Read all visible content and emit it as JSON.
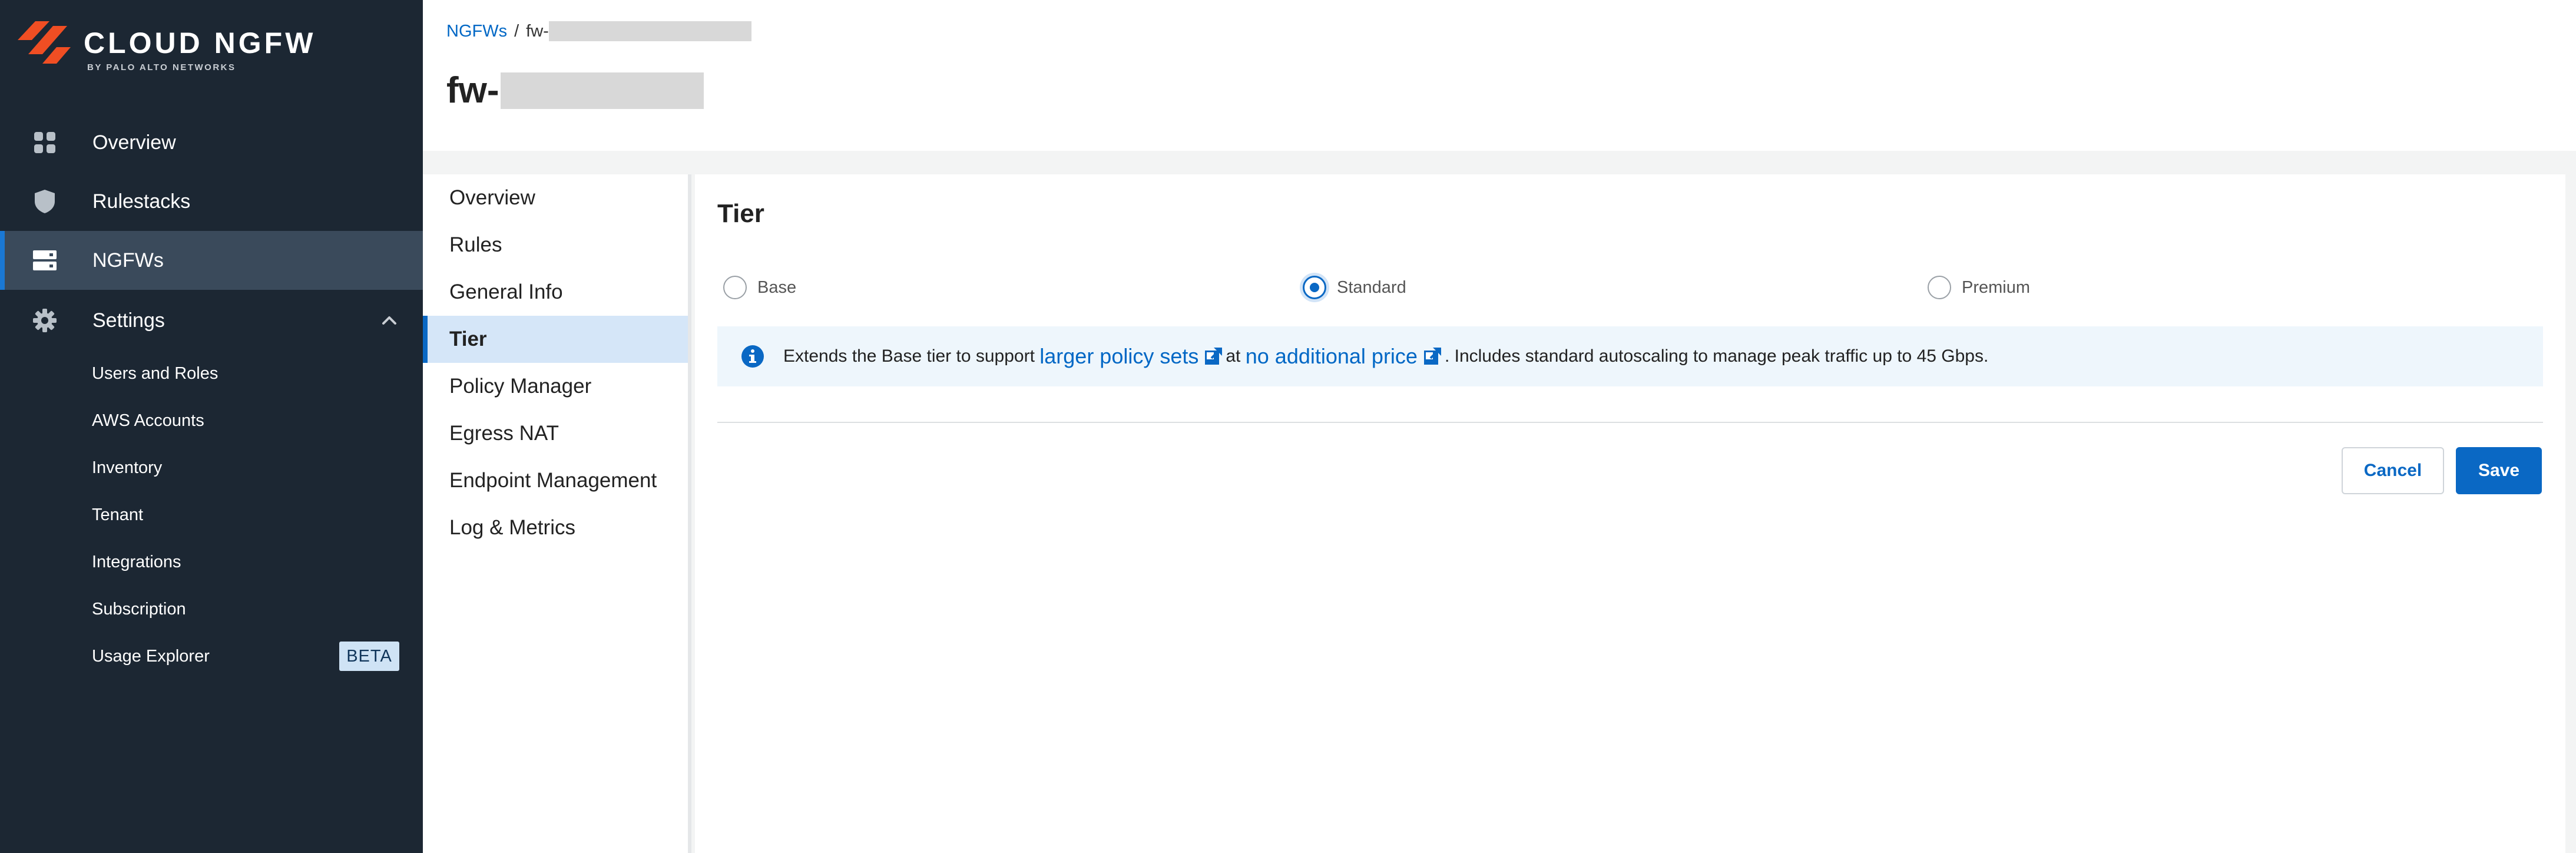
{
  "brand": {
    "name": "CLOUD NGFW",
    "subtitle": "BY PALO ALTO NETWORKS",
    "accent_color": "#f04e23"
  },
  "sidebar": {
    "items": [
      {
        "label": "Overview",
        "icon": "grid-icon"
      },
      {
        "label": "Rulestacks",
        "icon": "shield-icon"
      },
      {
        "label": "NGFWs",
        "icon": "server-icon",
        "active": true
      },
      {
        "label": "Settings",
        "icon": "gear-icon",
        "expanded": true
      }
    ],
    "settings_items": [
      {
        "label": "Users and Roles"
      },
      {
        "label": "AWS Accounts"
      },
      {
        "label": "Inventory"
      },
      {
        "label": "Tenant"
      },
      {
        "label": "Integrations"
      },
      {
        "label": "Subscription"
      },
      {
        "label": "Usage Explorer",
        "badge": "BETA"
      }
    ]
  },
  "header": {
    "breadcrumb": {
      "root": "NGFWs",
      "separator": "/",
      "current": "fw-"
    },
    "title": "fw-"
  },
  "subnav": {
    "items": [
      {
        "label": "Overview"
      },
      {
        "label": "Rules"
      },
      {
        "label": "General Info"
      },
      {
        "label": "Tier",
        "active": true
      },
      {
        "label": "Policy Manager"
      },
      {
        "label": "Egress NAT"
      },
      {
        "label": "Endpoint Management"
      },
      {
        "label": "Log & Metrics"
      }
    ]
  },
  "tier": {
    "title": "Tier",
    "options": [
      {
        "label": "Base",
        "checked": false
      },
      {
        "label": "Standard",
        "checked": true
      },
      {
        "label": "Premium",
        "checked": false
      }
    ],
    "info": {
      "prefix": "Extends the Base tier to support",
      "link1": "larger policy sets",
      "middle": "at",
      "link2": "no additional price",
      "suffix": ". Includes standard autoscaling to manage peak traffic up to 45 Gbps."
    },
    "buttons": {
      "cancel": "Cancel",
      "save": "Save"
    }
  },
  "colors": {
    "sidebar_bg": "#1c2733",
    "sidebar_active": "#3a4a5b",
    "primary": "#0a68c4",
    "link": "#0067c5",
    "info_bg": "#eef6fc",
    "subnav_active_bg": "#d5e6f8"
  }
}
